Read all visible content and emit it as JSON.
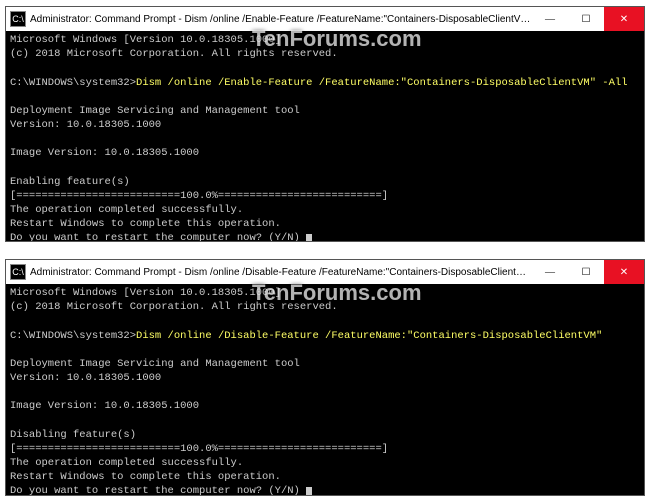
{
  "watermark": "TenForums.com",
  "window1": {
    "title": "Administrator: Command Prompt - Dism  /online /Enable-Feature /FeatureName:\"Containers-DisposableClientVM\" -All",
    "icon_glyph": "C:\\",
    "buttons": {
      "min": "—",
      "max": "☐",
      "close": "✕"
    },
    "lines": {
      "l0": "Microsoft Windows [Version 10.0.18305.1000]",
      "l1": "(c) 2018 Microsoft Corporation. All rights reserved.",
      "l2": "",
      "prompt": "C:\\WINDOWS\\system32>",
      "cmd": "Dism /online /Enable-Feature /FeatureName:\"Containers-DisposableClientVM\" -All",
      "l4": "",
      "l5": "Deployment Image Servicing and Management tool",
      "l6": "Version: 10.0.18305.1000",
      "l7": "",
      "l8": "Image Version: 10.0.18305.1000",
      "l9": "",
      "l10": "Enabling feature(s)",
      "l11": "[==========================100.0%==========================]",
      "l12": "The operation completed successfully.",
      "l13": "Restart Windows to complete this operation.",
      "l14": "Do you want to restart the computer now? (Y/N) "
    }
  },
  "window2": {
    "title": "Administrator: Command Prompt - Dism  /online /Disable-Feature /FeatureName:\"Containers-DisposableClientVM\"",
    "icon_glyph": "C:\\",
    "buttons": {
      "min": "—",
      "max": "☐",
      "close": "✕"
    },
    "lines": {
      "l0": "Microsoft Windows [Version 10.0.18305.1000]",
      "l1": "(c) 2018 Microsoft Corporation. All rights reserved.",
      "l2": "",
      "prompt": "C:\\WINDOWS\\system32>",
      "cmd": "Dism /online /Disable-Feature /FeatureName:\"Containers-DisposableClientVM\"",
      "l4": "",
      "l5": "Deployment Image Servicing and Management tool",
      "l6": "Version: 10.0.18305.1000",
      "l7": "",
      "l8": "Image Version: 10.0.18305.1000",
      "l9": "",
      "l10": "Disabling feature(s)",
      "l11": "[==========================100.0%==========================]",
      "l12": "The operation completed successfully.",
      "l13": "Restart Windows to complete this operation.",
      "l14": "Do you want to restart the computer now? (Y/N) "
    }
  }
}
